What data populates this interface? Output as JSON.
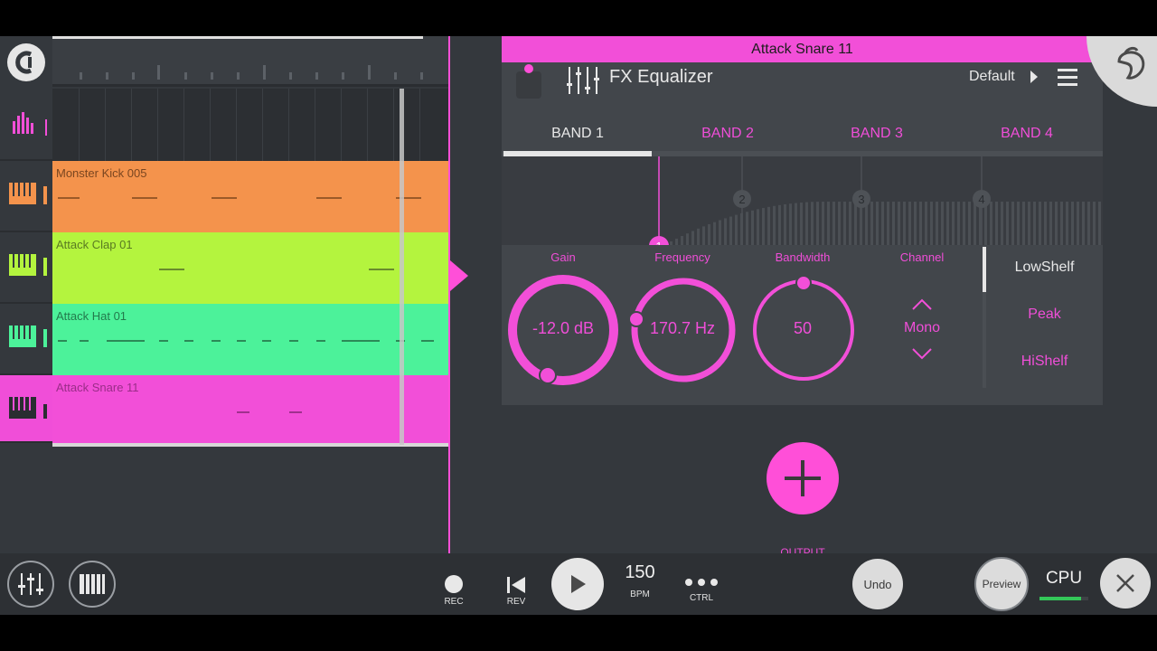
{
  "sequencer": {
    "tracks": [
      {
        "name": "Monster Kick 005",
        "color": "#f4934c"
      },
      {
        "name": "Attack Clap 01",
        "color": "#b4f43e"
      },
      {
        "name": "Attack Hat 01",
        "color": "#4cf29a"
      },
      {
        "name": "Attack Snare 11",
        "color": "#f24fd8"
      }
    ]
  },
  "fx": {
    "title": "Attack Snare 11",
    "effect_name": "FX Equalizer",
    "preset": "Default",
    "bands": [
      "BAND 1",
      "BAND 2",
      "BAND 3",
      "BAND 4"
    ],
    "active_band": 0,
    "band_markers": [
      "1",
      "2",
      "3",
      "4"
    ],
    "controls": {
      "gain_label": "Gain",
      "gain_value": "-12.0 dB",
      "frequency_label": "Frequency",
      "frequency_value": "170.7 Hz",
      "bandwidth_label": "Bandwidth",
      "bandwidth_value": "50",
      "channel_label": "Channel",
      "channel_value": "Mono"
    },
    "shapes": [
      "LowShelf",
      "Peak",
      "HiShelf"
    ],
    "active_shape": "LowShelf",
    "output_label": "OUTPUT"
  },
  "toolbar": {
    "rec_label": "REC",
    "rev_label": "REV",
    "bpm_value": "150",
    "bpm_label": "BPM",
    "ctrl_label": "CTRL",
    "undo_label": "Undo",
    "preview_label": "Preview",
    "cpu_label": "CPU",
    "cpu_load": 0.85
  },
  "colors": {
    "accent": "#f24fd8",
    "panel": "#42464b",
    "background": "#34383d"
  }
}
